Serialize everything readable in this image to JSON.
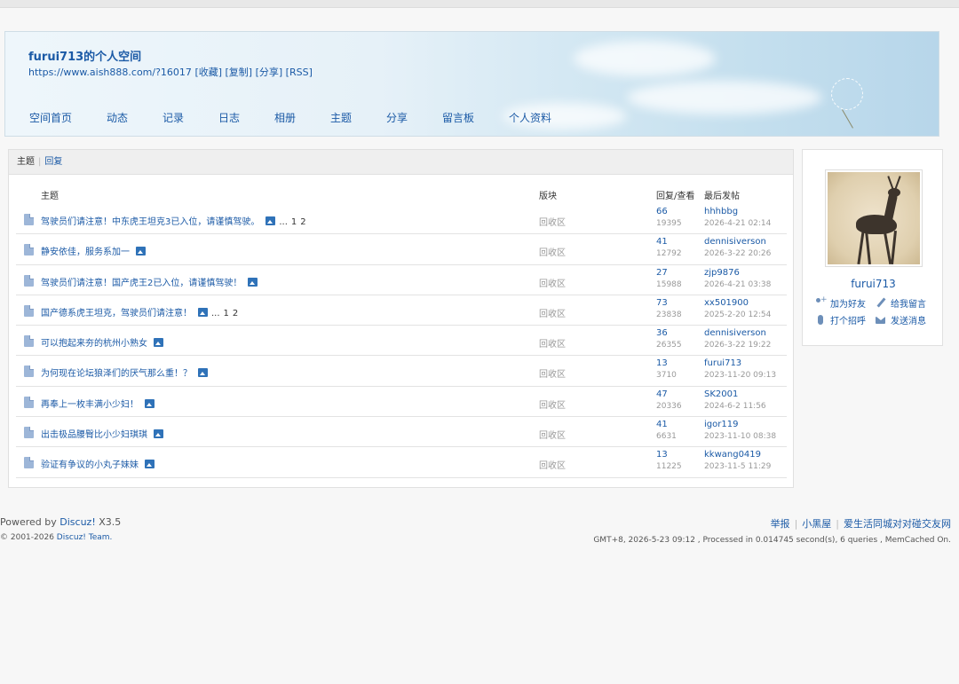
{
  "space": {
    "title": "furui713的个人空间",
    "url": "https://www.aish888.com/?16017",
    "url_actions": "[收藏] [复制] [分享] [RSS]"
  },
  "nav": [
    "空间首页",
    "动态",
    "记录",
    "日志",
    "相册",
    "主题",
    "分享",
    "留言板",
    "个人资料"
  ],
  "tabs": {
    "threads": "主题",
    "replies": "回复"
  },
  "table": {
    "col_subject": "主题",
    "col_forum": "版块",
    "col_stats": "回复/查看",
    "col_last": "最后发帖"
  },
  "threads": [
    {
      "title": "驾驶员们请注意！中东虎王坦克3已入位，请谨慎驾驶。",
      "pages": [
        "1",
        "2"
      ],
      "forum": "回收区",
      "replies": "66",
      "views": "19395",
      "last_user": "hhhbbg",
      "last_time": "2026-4-21 02:14"
    },
    {
      "title": "静安依佳，服务系加一",
      "pages": [],
      "forum": "回收区",
      "replies": "41",
      "views": "12792",
      "last_user": "dennisiverson",
      "last_time": "2026-3-22 20:26"
    },
    {
      "title": "驾驶员们请注意！国产虎王2已入位，请谨慎驾驶！",
      "pages": [],
      "forum": "回收区",
      "replies": "27",
      "views": "15988",
      "last_user": "zjp9876",
      "last_time": "2026-4-21 03:38"
    },
    {
      "title": "国产德系虎王坦克，驾驶员们请注意！",
      "pages": [
        "1",
        "2"
      ],
      "forum": "回收区",
      "replies": "73",
      "views": "23838",
      "last_user": "xx501900",
      "last_time": "2025-2-20 12:54"
    },
    {
      "title": "可以抱起来夯的杭州小熟女",
      "pages": [],
      "forum": "回收区",
      "replies": "36",
      "views": "26355",
      "last_user": "dennisiverson",
      "last_time": "2026-3-22 19:22"
    },
    {
      "title": "为何现在论坛狼泽们的厌气那么重！？",
      "pages": [],
      "forum": "回收区",
      "replies": "13",
      "views": "3710",
      "last_user": "furui713",
      "last_time": "2023-11-20 09:13"
    },
    {
      "title": "再奉上一枚丰满小少妇！",
      "pages": [],
      "forum": "回收区",
      "replies": "47",
      "views": "20336",
      "last_user": "SK2001",
      "last_time": "2024-6-2 11:56"
    },
    {
      "title": "出击极品腰臀比小少妇琪琪",
      "pages": [],
      "forum": "回收区",
      "replies": "41",
      "views": "6631",
      "last_user": "igor119",
      "last_time": "2023-11-10 08:38"
    },
    {
      "title": "验证有争议的小丸子妹妹",
      "pages": [],
      "forum": "回收区",
      "replies": "13",
      "views": "11225",
      "last_user": "kkwang0419",
      "last_time": "2023-11-5 11:29"
    }
  ],
  "profile": {
    "username": "furui713",
    "add_friend": "加为好友",
    "leave_message": "给我留言",
    "greet": "打个招呼",
    "send_message": "发送消息"
  },
  "footer": {
    "powered": "Powered by",
    "brand": "Discuz!",
    "version": "X3.5",
    "copyright": "© 2001-2026",
    "team": "Discuz! Team.",
    "links": [
      "举报",
      "小黑屋",
      "爱生活同城对对碰交友网"
    ],
    "info": "GMT+8, 2026-5-23 09:12 , Processed in 0.014745 second(s), 6 queries , MemCached On."
  },
  "colors": {
    "link": "#1b5aa6",
    "muted": "#999999",
    "banner": "#c4dfee"
  }
}
